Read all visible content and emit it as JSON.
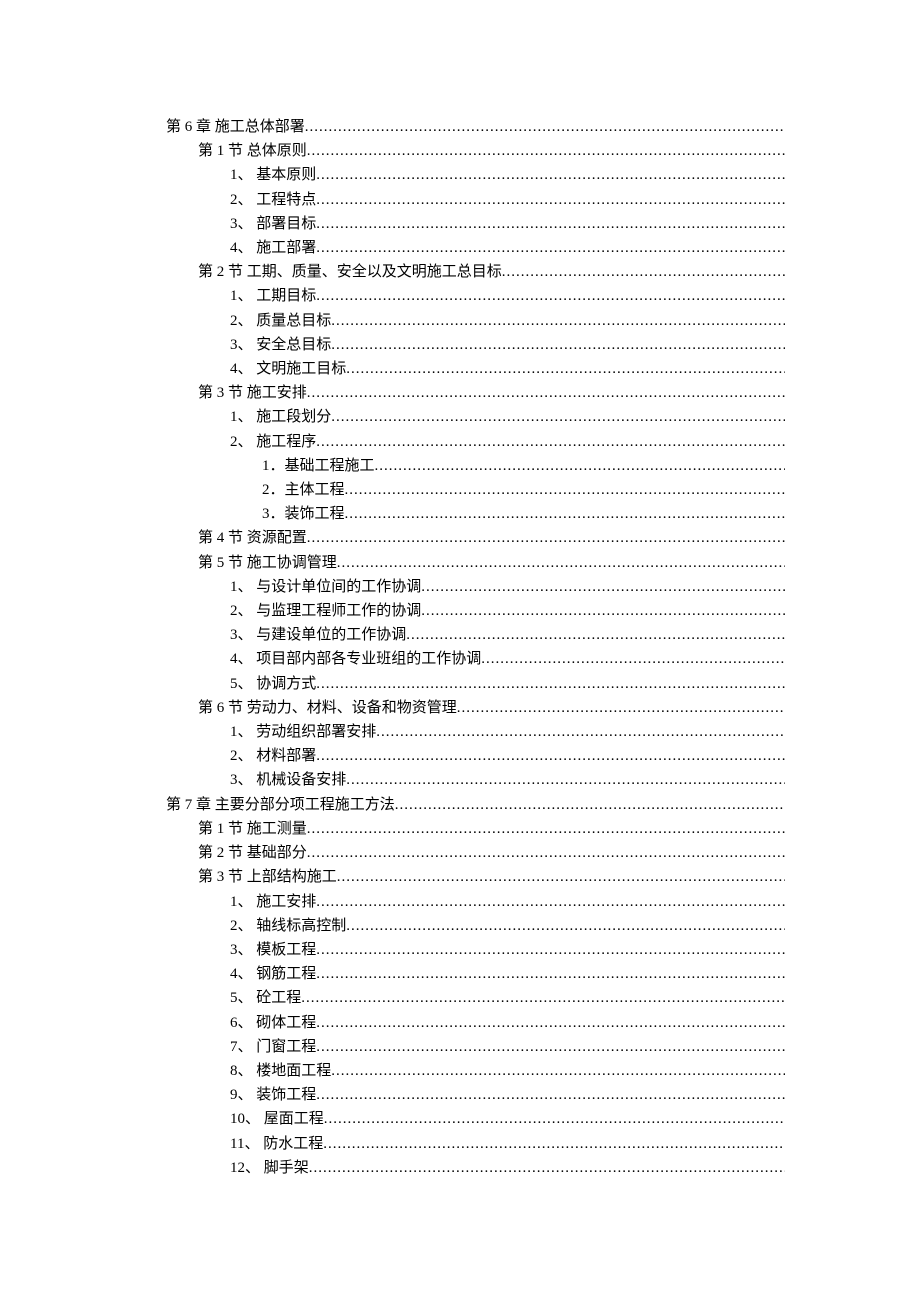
{
  "toc": [
    {
      "level": 0,
      "label": "第 6 章  施工总体部署"
    },
    {
      "level": 1,
      "label": "第 1 节  总体原则"
    },
    {
      "level": 2,
      "label": "1、   基本原则"
    },
    {
      "level": 2,
      "label": "2、   工程特点"
    },
    {
      "level": 2,
      "label": "3、   部署目标"
    },
    {
      "level": 2,
      "label": "4、   施工部署"
    },
    {
      "level": 1,
      "label": "第 2 节  工期、质量、安全以及文明施工总目标"
    },
    {
      "level": 2,
      "label": "1、   工期目标"
    },
    {
      "level": 2,
      "label": "2、   质量总目标"
    },
    {
      "level": 2,
      "label": "3、   安全总目标"
    },
    {
      "level": 2,
      "label": "4、   文明施工目标"
    },
    {
      "level": 1,
      "label": "第 3 节  施工安排"
    },
    {
      "level": 2,
      "label": "1、   施工段划分"
    },
    {
      "level": 2,
      "label": "2、   施工程序"
    },
    {
      "level": 3,
      "label": "1．基础工程施工"
    },
    {
      "level": 3,
      "label": "2．主体工程"
    },
    {
      "level": 3,
      "label": "3．装饰工程"
    },
    {
      "level": 1,
      "label": "第 4 节  资源配置"
    },
    {
      "level": 1,
      "label": "第 5 节  施工协调管理"
    },
    {
      "level": 2,
      "label": "1、   与设计单位间的工作协调"
    },
    {
      "level": 2,
      "label": "2、   与监理工程师工作的协调"
    },
    {
      "level": 2,
      "label": "3、   与建设单位的工作协调"
    },
    {
      "level": 2,
      "label": "4、   项目部内部各专业班组的工作协调"
    },
    {
      "level": 2,
      "label": "5、   协调方式"
    },
    {
      "level": 1,
      "label": "第 6 节  劳动力、材料、设备和物资管理"
    },
    {
      "level": 2,
      "label": "1、   劳动组织部署安排"
    },
    {
      "level": 2,
      "label": "2、   材料部署"
    },
    {
      "level": 2,
      "label": "3、   机械设备安排"
    },
    {
      "level": 0,
      "label": "第 7 章  主要分部分项工程施工方法"
    },
    {
      "level": 1,
      "label": "第 1 节  施工测量"
    },
    {
      "level": 1,
      "label": "第 2 节  基础部分"
    },
    {
      "level": 1,
      "label": "第 3 节  上部结构施工"
    },
    {
      "level": 2,
      "label": "1、   施工安排"
    },
    {
      "level": 2,
      "label": "2、   轴线标高控制"
    },
    {
      "level": 2,
      "label": "3、   模板工程"
    },
    {
      "level": 2,
      "label": "4、   钢筋工程"
    },
    {
      "level": 2,
      "label": "5、   砼工程"
    },
    {
      "level": 2,
      "label": "6、   砌体工程"
    },
    {
      "level": 2,
      "label": "7、   门窗工程"
    },
    {
      "level": 2,
      "label": "8、   楼地面工程"
    },
    {
      "level": 2,
      "label": "9、   装饰工程"
    },
    {
      "level": 2,
      "label": "10、  屋面工程"
    },
    {
      "level": 2,
      "label": "11、  防水工程"
    },
    {
      "level": 2,
      "label": "12、  脚手架"
    }
  ]
}
